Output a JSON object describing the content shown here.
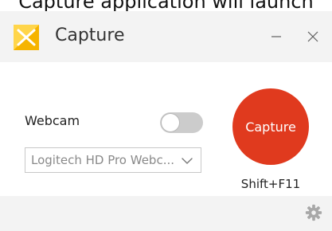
{
  "caption": "Capture application will launch",
  "window": {
    "title": "Capture",
    "minimize_icon": "minimize-icon",
    "close_icon": "close-icon",
    "app_icon": "capture-app-icon"
  },
  "webcam": {
    "label": "Webcam",
    "toggle_state": "off",
    "selected_device": "Logitech HD Pro Webc..."
  },
  "capture": {
    "label": "Capture",
    "shortcut": "Shift+F11"
  },
  "footer": {
    "settings_icon": "gear-icon"
  },
  "colors": {
    "accent": "#e03a1e",
    "titlebar": "#f3f3f3",
    "app_icon": "#f6b400"
  }
}
